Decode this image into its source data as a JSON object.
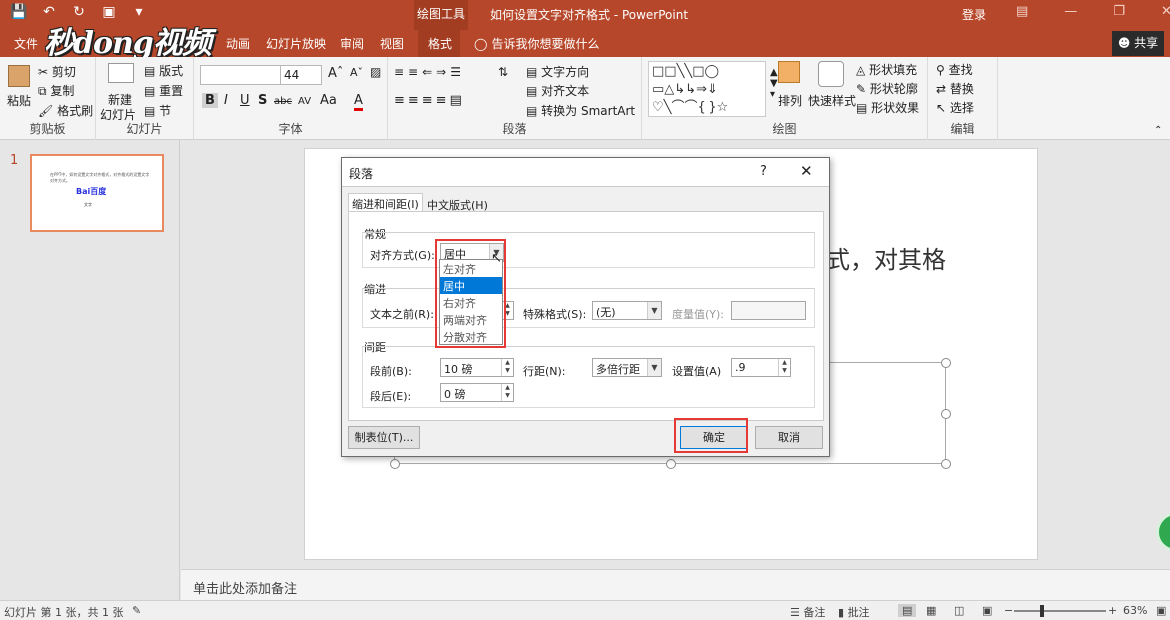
{
  "titlebar": {
    "quick_access": [
      "save-icon",
      "undo-icon",
      "redo-icon",
      "start-slideshow-icon",
      "customize-icon"
    ],
    "context_tool_label": "绘图工具",
    "document_title": "如何设置文字对齐格式 - PowerPoint",
    "login_label": "登录",
    "window_buttons": [
      "ribbon-display-icon",
      "minimize-icon",
      "restore-icon",
      "close-icon"
    ]
  },
  "tabs": {
    "file": "文件",
    "animation": "动画",
    "slideshow": "幻灯片放映",
    "review": "审阅",
    "view": "视图",
    "format": "格式",
    "tellme": "告诉我你想要做什么",
    "share": "共享"
  },
  "watermark_logo": "秒dong视频",
  "ribbon": {
    "clipboard": {
      "label": "剪贴板",
      "paste": "粘贴",
      "cut": "剪切",
      "copy": "复制",
      "format_painter": "格式刷"
    },
    "slides": {
      "label": "幻灯片",
      "new_slide_1": "新建",
      "new_slide_2": "幻灯片",
      "layout": "版式",
      "reset": "重置",
      "section": "节"
    },
    "font": {
      "label": "字体",
      "font_name": "",
      "font_size": "44",
      "bold": "B",
      "italic": "I",
      "underline": "U",
      "shadow": "S",
      "strike": "abc",
      "spacing": "AV",
      "case": "Aa",
      "color": "A"
    },
    "paragraph": {
      "label": "段落",
      "text_direction": "文字方向",
      "align_text": "对齐文本",
      "smartart": "转换为 SmartArt"
    },
    "drawing": {
      "label": "绘图",
      "arrange": "排列",
      "quick_styles": "快速样式",
      "shape_fill": "形状填充",
      "shape_outline": "形状轮廓",
      "shape_effects": "形状效果"
    },
    "editing": {
      "label": "编辑",
      "find": "查找",
      "replace": "替换",
      "select": "选择"
    }
  },
  "thumbnail": {
    "slide_number": "1",
    "line1": "在PPT中，如何设置文字对齐格式，对齐格式的设置文字对齐方式。",
    "line2": "Bai百度",
    "line3": "文字"
  },
  "slide": {
    "visible_text": "式，对其格"
  },
  "notes_placeholder": "单击此处添加备注",
  "status": {
    "slide_info": "幻灯片 第 1 张，共 1 张",
    "notes": "备注",
    "comments": "批注",
    "zoom": "63%",
    "zoom_level_percent": 63
  },
  "dialog": {
    "title": "段落",
    "help": "?",
    "close": "✕",
    "tabs": [
      "缩进和间距(I)",
      "中文版式(H)"
    ],
    "general": {
      "title": "常规",
      "alignment_label": "对齐方式(G):",
      "alignment_value": "居中",
      "alignment_options": [
        "左对齐",
        "居中",
        "右对齐",
        "两端对齐",
        "分散对齐"
      ],
      "alignment_selected_index": 1
    },
    "indent": {
      "title": "缩进",
      "before_text_label": "文本之前(R):",
      "special_label": "特殊格式(S):",
      "special_value": "(无)",
      "measure_label": "度量值(Y):",
      "measure_value": ""
    },
    "spacing": {
      "title": "间距",
      "before_label": "段前(B):",
      "before_value": "10 磅",
      "after_label": "段后(E):",
      "after_value": "0 磅",
      "line_label": "行距(N):",
      "line_value": "多倍行距",
      "setting_label": "设置值(A)",
      "setting_value": ".9"
    },
    "buttons": {
      "tabs": "制表位(T)...",
      "ok": "确定",
      "cancel": "取消"
    }
  },
  "highlight_color": "#e53935",
  "accent_color": "#b7472a"
}
